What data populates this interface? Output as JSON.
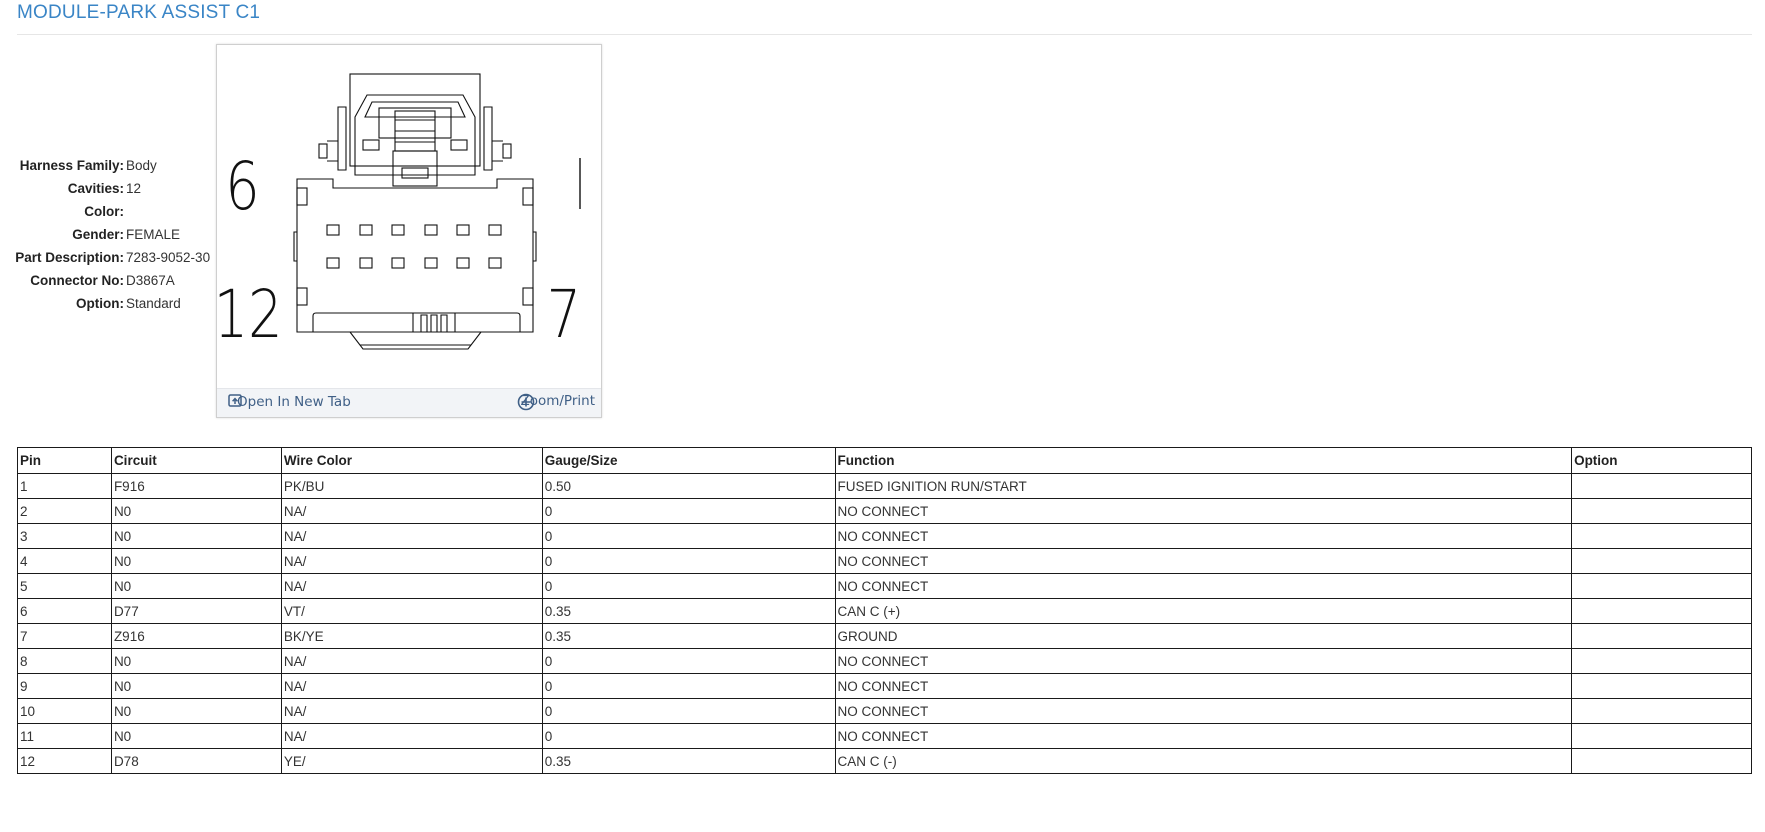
{
  "page": {
    "title": "MODULE-PARK ASSIST C1"
  },
  "properties": [
    {
      "key": "Harness Family:",
      "value": "Body"
    },
    {
      "key": "Cavities:",
      "value": "12"
    },
    {
      "key": "Color:",
      "value": ""
    },
    {
      "key": "Gender:",
      "value": "FEMALE"
    },
    {
      "key": "Part Description:",
      "value": "7283-9052-30"
    },
    {
      "key": "Connector No:",
      "value": "D3867A"
    },
    {
      "key": "Option:",
      "value": "Standard"
    }
  ],
  "diagram": {
    "labels": {
      "top_left": "6",
      "top_right": "1",
      "bottom_left": "12",
      "bottom_right": "7"
    },
    "open_tab_label": "Open In New Tab",
    "zoom_label": "Zoom/Print",
    "icons": {
      "open": "open-new-tab-icon",
      "zoom": "zoom-plus-icon"
    }
  },
  "table": {
    "headers": [
      "Pin",
      "Circuit",
      "Wire Color",
      "Gauge/Size",
      "Function",
      "Option"
    ],
    "rows": [
      [
        "1",
        "F916",
        "PK/BU",
        "0.50",
        "FUSED IGNITION RUN/START",
        ""
      ],
      [
        "2",
        "N0",
        "NA/",
        "0",
        "NO CONNECT",
        ""
      ],
      [
        "3",
        "N0",
        "NA/",
        "0",
        "NO CONNECT",
        ""
      ],
      [
        "4",
        "N0",
        "NA/",
        "0",
        "NO CONNECT",
        ""
      ],
      [
        "5",
        "N0",
        "NA/",
        "0",
        "NO CONNECT",
        ""
      ],
      [
        "6",
        "D77",
        "VT/",
        "0.35",
        "CAN C (+)",
        ""
      ],
      [
        "7",
        "Z916",
        "BK/YE",
        "0.35",
        "GROUND",
        ""
      ],
      [
        "8",
        "N0",
        "NA/",
        "0",
        "NO CONNECT",
        ""
      ],
      [
        "9",
        "N0",
        "NA/",
        "0",
        "NO CONNECT",
        ""
      ],
      [
        "10",
        "N0",
        "NA/",
        "0",
        "NO CONNECT",
        ""
      ],
      [
        "11",
        "N0",
        "NA/",
        "0",
        "NO CONNECT",
        ""
      ],
      [
        "12",
        "D78",
        "YE/",
        "0.35",
        "CAN C (-)",
        ""
      ]
    ]
  },
  "colors": {
    "title": "#3a85c6",
    "link": "#3f5f86"
  }
}
